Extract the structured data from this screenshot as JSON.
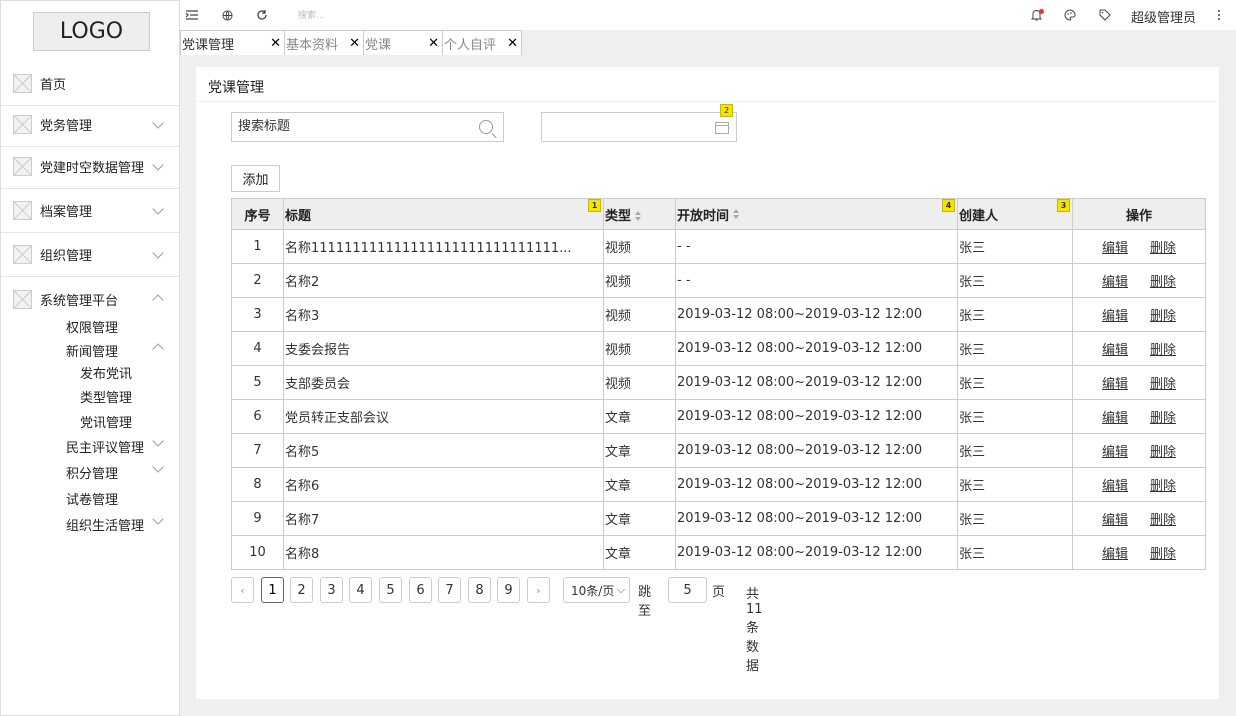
{
  "sidebar": {
    "logo": "LOGO",
    "items": [
      {
        "label": "首页"
      },
      {
        "label": "党务管理"
      },
      {
        "label": "党建时空数据管理"
      },
      {
        "label": "档案管理"
      },
      {
        "label": "组织管理"
      },
      {
        "label": "系统管理平台"
      }
    ],
    "sub_items": [
      "权限管理",
      "新闻管理",
      "发布党讯",
      "类型管理",
      "党讯管理",
      "民主评议管理",
      "积分管理",
      "试卷管理",
      "组织生活管理"
    ]
  },
  "topbar": {
    "search_placeholder": "搜索...",
    "admin": "超级管理员"
  },
  "tabs": [
    {
      "label": "党课管理"
    },
    {
      "label": "基本资料"
    },
    {
      "label": "党课"
    },
    {
      "label": "个人自评"
    }
  ],
  "tab_close": "✕",
  "panel": {
    "title": "党课管理",
    "search_placeholder": "搜索标题",
    "add_label": "添加",
    "badges": [
      "1",
      "2",
      "3",
      "4"
    ]
  },
  "table": {
    "headers": [
      "序号",
      "标题",
      "类型",
      "开放时间",
      "创建人",
      "操作"
    ],
    "edit": "编辑",
    "delete": "删除",
    "rows": [
      [
        "1",
        "名称111111111111111111111111111111...",
        "视频",
        "- -",
        "张三"
      ],
      [
        "2",
        "名称2",
        "视频",
        "- -",
        "张三"
      ],
      [
        "3",
        "名称3",
        "视频",
        "2019-03-12 08:00~2019-03-12 12:00",
        "张三"
      ],
      [
        "4",
        "支委会报告",
        "视频",
        "2019-03-12 08:00~2019-03-12 12:00",
        "张三"
      ],
      [
        "5",
        "支部委员会",
        "视频",
        "2019-03-12 08:00~2019-03-12 12:00",
        "张三"
      ],
      [
        "6",
        "党员转正支部会议",
        "文章",
        "2019-03-12 08:00~2019-03-12 12:00",
        "张三"
      ],
      [
        "7",
        "名称5",
        "文章",
        "2019-03-12 08:00~2019-03-12 12:00",
        "张三"
      ],
      [
        "8",
        "名称6",
        "文章",
        "2019-03-12 08:00~2019-03-12 12:00",
        "张三"
      ],
      [
        "9",
        "名称7",
        "文章",
        "2019-03-12 08:00~2019-03-12 12:00",
        "张三"
      ],
      [
        "10",
        "名称8",
        "文章",
        "2019-03-12 08:00~2019-03-12 12:00",
        "张三"
      ]
    ]
  },
  "pager": {
    "pages": [
      "1",
      "2",
      "3",
      "4",
      "5",
      "6",
      "7",
      "8",
      "9"
    ],
    "current": "1",
    "prev": "‹",
    "next": "›",
    "page_size": "10条/页",
    "jump_label": "跳至",
    "jump_value": "5",
    "jump_suffix": "页",
    "total": "共11条数据"
  }
}
